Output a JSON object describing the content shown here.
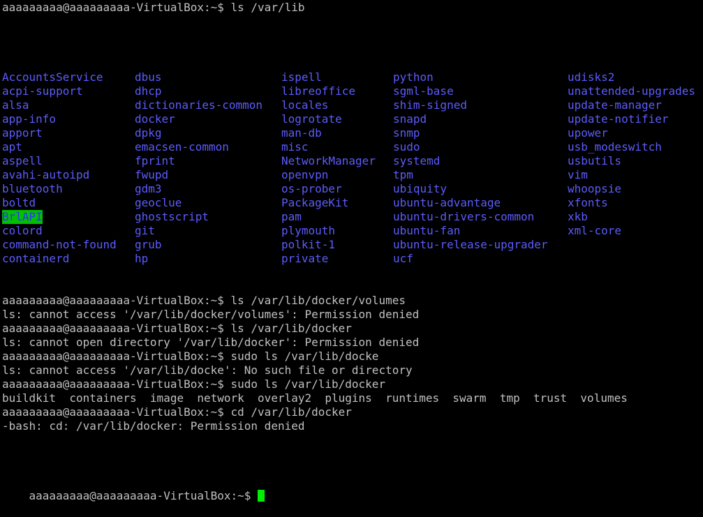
{
  "terminal": {
    "prompt": "aaaaaaaaa@aaaaaaaaa-VirtualBox:~$",
    "first_command": "aaaaaaaaa@aaaaaaaaa-VirtualBox:~$ ls /var/lib",
    "highlight_color": "#00c000",
    "dir_color": "#5c5cff",
    "text_color": "#c0c0c0",
    "cursor_color": "#00ee00",
    "listing_rows": [
      [
        "AccountsService",
        "dbus",
        "ispell",
        "python",
        "udisks2"
      ],
      [
        "acpi-support",
        "dhcp",
        "libreoffice",
        "sgml-base",
        "unattended-upgrades"
      ],
      [
        "alsa",
        "dictionaries-common",
        "locales",
        "shim-signed",
        "update-manager"
      ],
      [
        "app-info",
        "docker",
        "logrotate",
        "snapd",
        "update-notifier"
      ],
      [
        "apport",
        "dpkg",
        "man-db",
        "snmp",
        "upower"
      ],
      [
        "apt",
        "emacsen-common",
        "misc",
        "sudo",
        "usb_modeswitch"
      ],
      [
        "aspell",
        "fprint",
        "NetworkManager",
        "systemd",
        "usbutils"
      ],
      [
        "avahi-autoipd",
        "fwupd",
        "openvpn",
        "tpm",
        "vim"
      ],
      [
        "bluetooth",
        "gdm3",
        "os-prober",
        "ubiquity",
        "whoopsie"
      ],
      [
        "boltd",
        "geoclue",
        "PackageKit",
        "ubuntu-advantage",
        "xfonts"
      ],
      [
        "BrlAPI",
        "ghostscript",
        "pam",
        "ubuntu-drivers-common",
        "xkb"
      ],
      [
        "colord",
        "git",
        "plymouth",
        "ubuntu-fan",
        "xml-core"
      ],
      [
        "command-not-found",
        "grub",
        "polkit-1",
        "ubuntu-release-upgrader",
        ""
      ],
      [
        "containerd",
        "hp",
        "private",
        "ucf",
        ""
      ]
    ],
    "after_lines": [
      "aaaaaaaaa@aaaaaaaaa-VirtualBox:~$ ls /var/lib/docker/volumes",
      "ls: cannot access '/var/lib/docker/volumes': Permission denied",
      "aaaaaaaaa@aaaaaaaaa-VirtualBox:~$ ls /var/lib/docker",
      "ls: cannot open directory '/var/lib/docker': Permission denied",
      "aaaaaaaaa@aaaaaaaaa-VirtualBox:~$ sudo ls /var/lib/docke",
      "ls: cannot access '/var/lib/docke': No such file or directory",
      "aaaaaaaaa@aaaaaaaaa-VirtualBox:~$ sudo ls /var/lib/docker",
      "buildkit  containers  image  network  overlay2  plugins  runtimes  swarm  tmp  trust  volumes",
      "aaaaaaaaa@aaaaaaaaa-VirtualBox:~$ cd /var/lib/docker",
      "-bash: cd: /var/lib/docker: Permission denied"
    ],
    "final_prompt": "aaaaaaaaa@aaaaaaaaa-VirtualBox:~$"
  }
}
